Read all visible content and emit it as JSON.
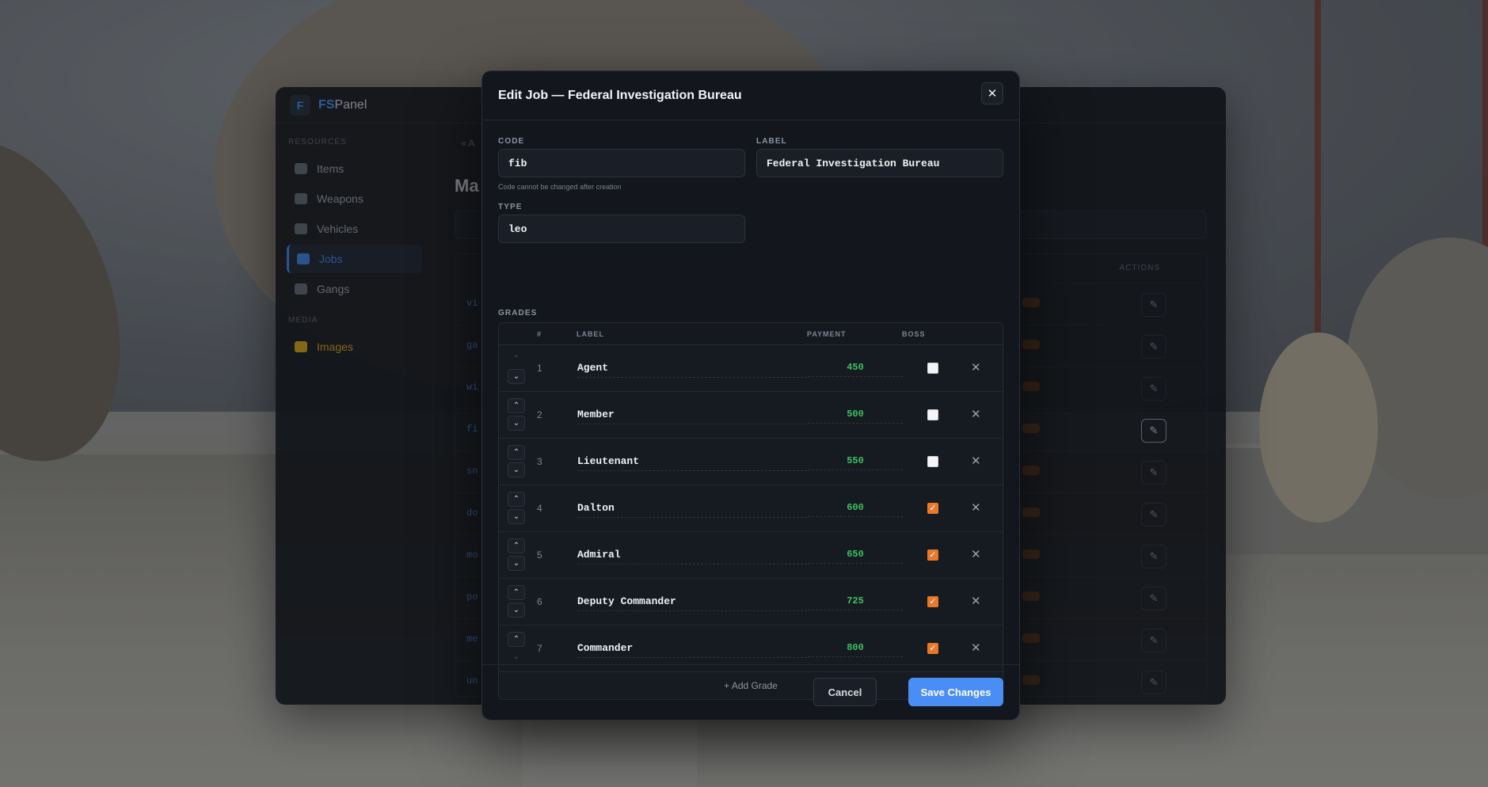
{
  "panel": {
    "brand_prefix": "FS",
    "brand_suffix": "Panel",
    "logo_letter": "F",
    "sidebar": {
      "section_resources": "RESOURCES",
      "section_media": "MEDIA",
      "items": [
        {
          "label": "Items",
          "icon": "box-icon"
        },
        {
          "label": "Weapons",
          "icon": "gun-icon"
        },
        {
          "label": "Vehicles",
          "icon": "car-icon"
        },
        {
          "label": "Jobs",
          "icon": "briefcase-icon",
          "active": true
        },
        {
          "label": "Gangs",
          "icon": "flag-icon"
        }
      ],
      "media_items": [
        {
          "label": "Images",
          "icon": "image-icon"
        }
      ]
    },
    "crumb": "« A",
    "title": "Ma",
    "table_actions_header": "ACTIONS",
    "rows": [
      {
        "code": "vi"
      },
      {
        "code": "ga"
      },
      {
        "code": "wi"
      },
      {
        "code": "fi"
      },
      {
        "code": "sn"
      },
      {
        "code": "do"
      },
      {
        "code": "mo"
      },
      {
        "code": "po"
      },
      {
        "code": "me"
      },
      {
        "code": "un"
      }
    ]
  },
  "modal": {
    "title": "Edit Job — Federal Investigation Bureau",
    "close_glyph": "✕",
    "fields": {
      "code_label": "CODE",
      "code_value": "fib",
      "code_hint": "Code cannot be changed after creation",
      "label_label": "LABEL",
      "label_value": "Federal Investigation Bureau",
      "type_label": "TYPE",
      "type_value": "leo"
    },
    "grades": {
      "section_label": "GRADES",
      "headers": {
        "num": "#",
        "label": "LABEL",
        "payment": "PAYMENT",
        "boss": "BOSS"
      },
      "rows": [
        {
          "num": "1",
          "label": "Agent",
          "payment": "450",
          "boss": false
        },
        {
          "num": "2",
          "label": "Member",
          "payment": "500",
          "boss": false
        },
        {
          "num": "3",
          "label": "Lieutenant",
          "payment": "550",
          "boss": false
        },
        {
          "num": "4",
          "label": "Dalton",
          "payment": "600",
          "boss": true
        },
        {
          "num": "5",
          "label": "Admiral",
          "payment": "650",
          "boss": true
        },
        {
          "num": "6",
          "label": "Deputy Commander",
          "payment": "725",
          "boss": true
        },
        {
          "num": "7",
          "label": "Commander",
          "payment": "800",
          "boss": true
        }
      ],
      "add_label": "+ Add Grade"
    },
    "footer": {
      "cancel_label": "Cancel",
      "save_label": "Save Changes"
    }
  },
  "colors": {
    "accent": "#4a8ef5",
    "payment": "#3fbf63",
    "boss_checked": "#e8782a"
  }
}
